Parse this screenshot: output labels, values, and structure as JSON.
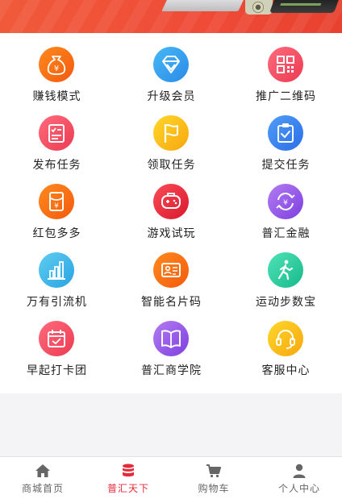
{
  "grid": {
    "items": [
      {
        "label": "赚钱模式",
        "icon": "money-bag-icon",
        "color": "#f36a12"
      },
      {
        "label": "升级会员",
        "icon": "diamond-icon",
        "color": "#3aa6f2"
      },
      {
        "label": "推广二维码",
        "icon": "qr-code-icon",
        "color": "#f3495c"
      },
      {
        "label": "发布任务",
        "icon": "checklist-icon",
        "color": "#f3495c"
      },
      {
        "label": "领取任务",
        "icon": "flag-icon",
        "color": "#f8b61a"
      },
      {
        "label": "提交任务",
        "icon": "clipboard-check-icon",
        "color": "#3a84ef"
      },
      {
        "label": "红包多多",
        "icon": "red-envelope-icon",
        "color": "#f36a12"
      },
      {
        "label": "游戏试玩",
        "icon": "gamepad-icon",
        "color": "#e1232f"
      },
      {
        "label": "普汇金融",
        "icon": "yuan-exchange-icon",
        "color": "#9554e8"
      },
      {
        "label": "万有引流机",
        "icon": "bar-chart-icon",
        "color": "#3aa6f2"
      },
      {
        "label": "智能名片码",
        "icon": "business-card-icon",
        "color": "#f36a12"
      },
      {
        "label": "运动步数宝",
        "icon": "walking-person-icon",
        "color": "#1fc896"
      },
      {
        "label": "早起打卡团",
        "icon": "calendar-check-icon",
        "color": "#ec3b52"
      },
      {
        "label": "普汇商学院",
        "icon": "open-book-icon",
        "color": "#9554e8"
      },
      {
        "label": "客服中心",
        "icon": "headset-icon",
        "color": "#f8b61a"
      }
    ]
  },
  "tabbar": {
    "tabs": [
      {
        "label": "商城首页",
        "icon": "home-icon"
      },
      {
        "label": "普汇天下",
        "icon": "database-icon"
      },
      {
        "label": "购物车",
        "icon": "shopping-cart-icon"
      },
      {
        "label": "个人中心",
        "icon": "person-icon"
      }
    ],
    "active_color": "#e52b3a",
    "inactive_color": "#666666"
  }
}
